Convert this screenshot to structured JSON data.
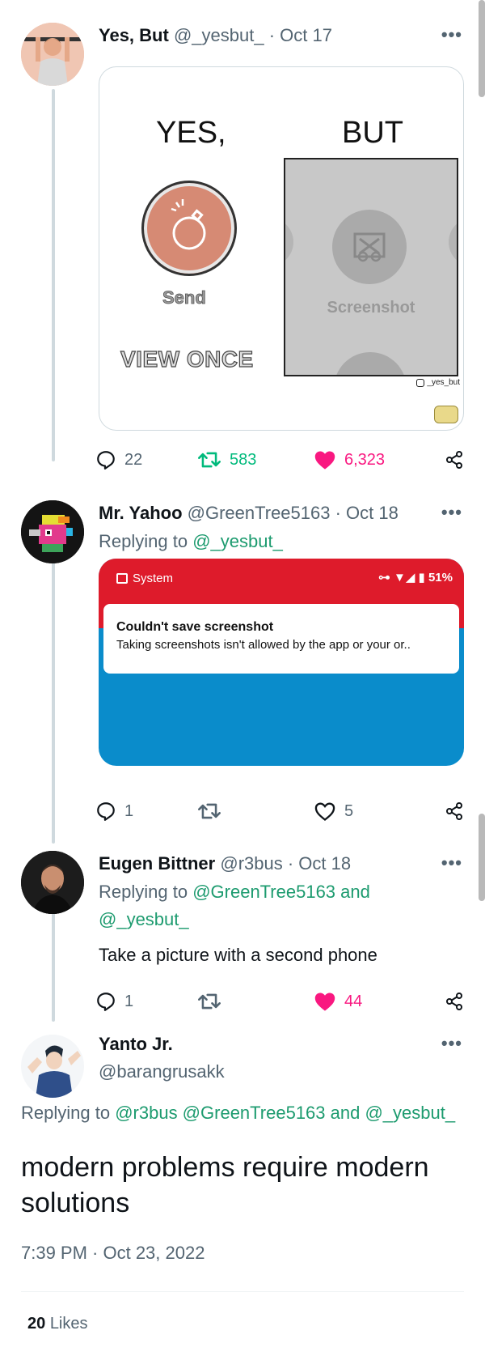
{
  "tweets": [
    {
      "name": "Yes, But",
      "handle": "@_yesbut_",
      "date": "· Oct 17",
      "meme": {
        "left_caption": "YES,",
        "right_caption": "BUT",
        "send_label": "Send",
        "view_once_label": "VIEW ONCE",
        "screenshot_label": "Screenshot",
        "credit": "_yes_but"
      },
      "replies": "22",
      "retweets": "583",
      "likes": "6,323"
    },
    {
      "name": "Mr. Yahoo",
      "handle": "@GreenTree5163",
      "date": "· Oct 18",
      "replying_prefix": "Replying to",
      "replying_to": "@_yesbut_",
      "screenshot": {
        "app_label": "System",
        "status": "51%",
        "title": "Couldn't save screenshot",
        "body": "Taking screenshots isn't allowed by the app or your or.."
      },
      "replies": "1",
      "likes": "5"
    },
    {
      "name": "Eugen Bittner",
      "handle": "@r3bus",
      "date": "· Oct 18",
      "replying_prefix": "Replying to",
      "replying_to_1": "@GreenTree5163",
      "replying_and": "and",
      "replying_to_2": "@_yesbut_",
      "text": "Take a picture with a second phone",
      "replies": "1",
      "likes": "44"
    }
  ],
  "main": {
    "name": "Yanto Jr.",
    "handle": "@barangrusakk",
    "replying_prefix": "Replying to",
    "replying_to": "@r3bus @GreenTree5163 and @_yesbut_",
    "text": "modern problems require modern solutions",
    "timestamp": "7:39 PM · Oct 23, 2022",
    "likes_count": "20",
    "likes_label": "Likes"
  },
  "more_label": "•••",
  "colors": {
    "retweet_green": "#00ba7c",
    "like_pink": "#f91880",
    "link_green": "#1d9b6f"
  }
}
